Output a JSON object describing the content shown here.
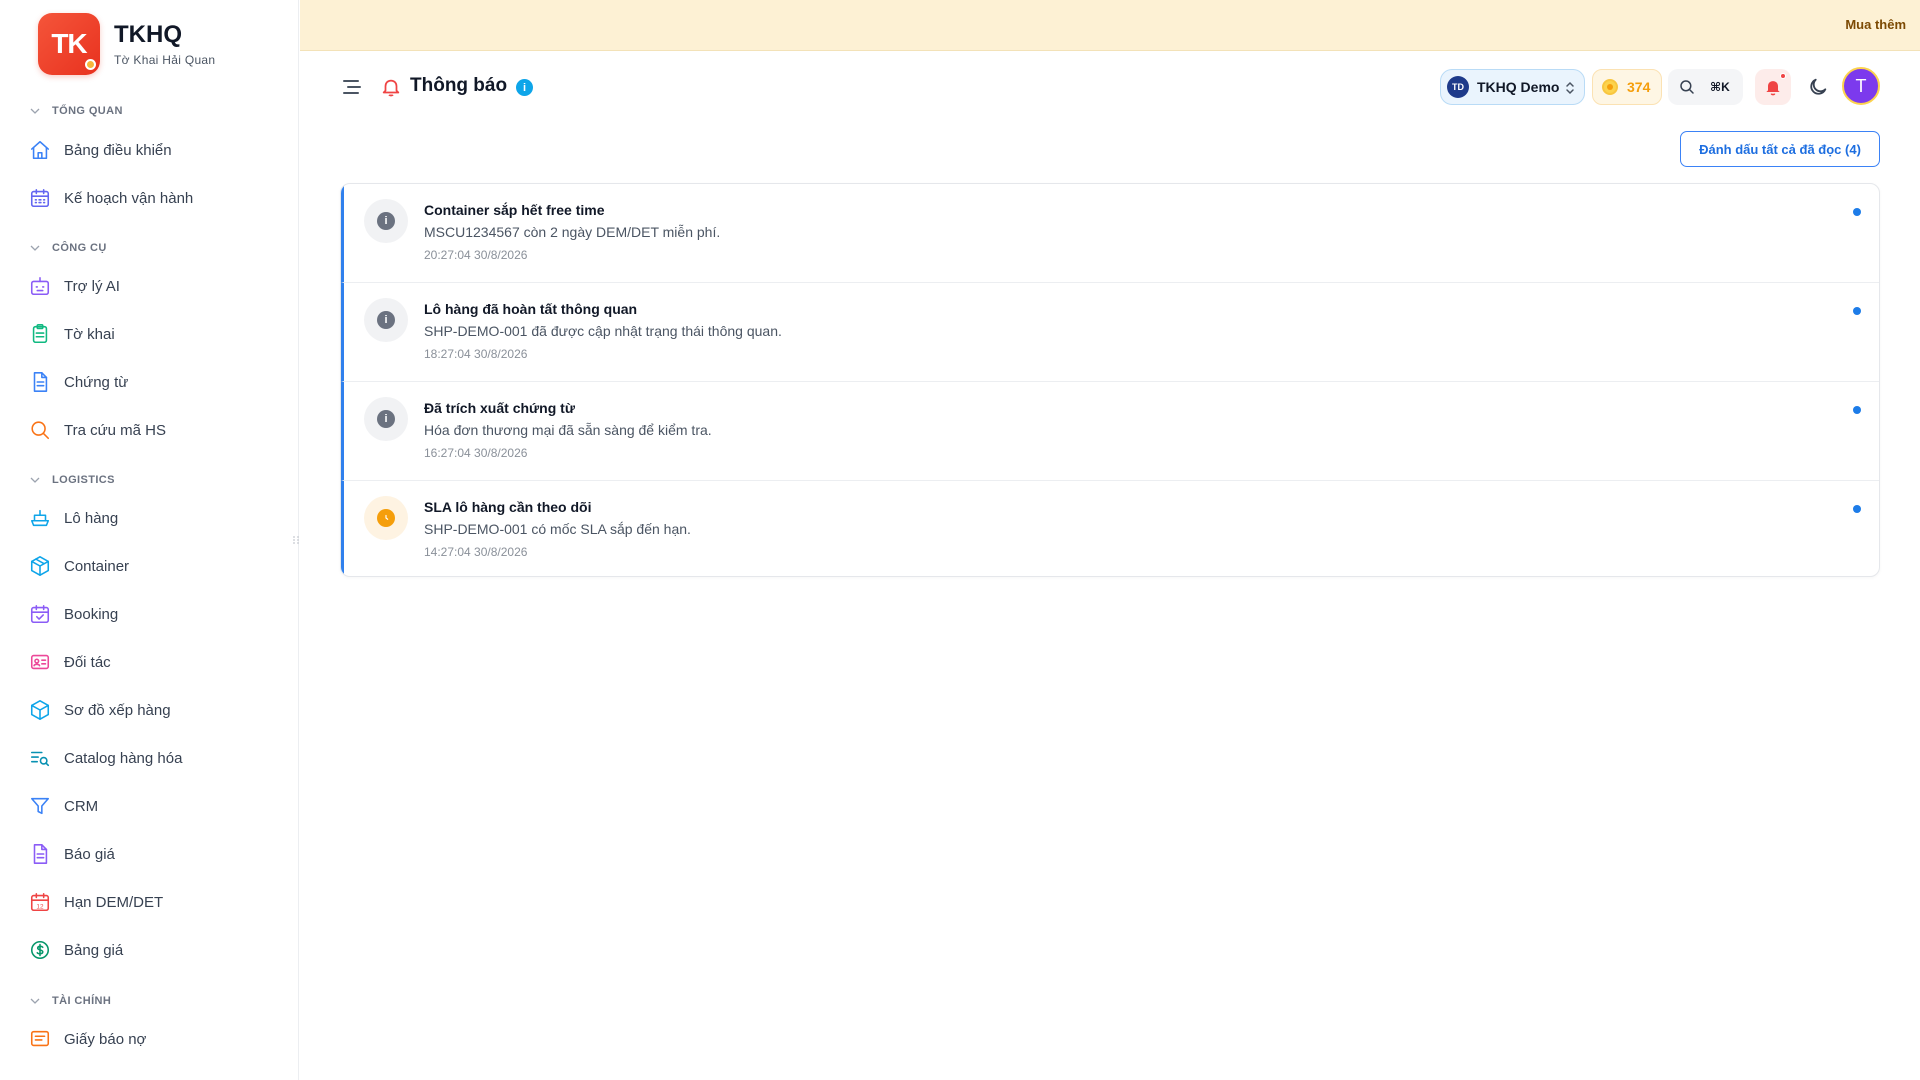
{
  "brand": {
    "logo_text": "TK",
    "name": "TKHQ",
    "subtitle": "Tờ Khai Hải Quan"
  },
  "banner": {
    "cta": "Mua thêm"
  },
  "sidebar": {
    "sections": [
      {
        "label": "TỔNG QUAN",
        "items": [
          {
            "label": "Bảng điều khiển",
            "icon": "home-icon"
          },
          {
            "label": "Kế hoạch vận hành",
            "icon": "calendar-grid-icon"
          }
        ]
      },
      {
        "label": "CÔNG CỤ",
        "items": [
          {
            "label": "Trợ lý AI",
            "icon": "bot-icon"
          },
          {
            "label": "Tờ khai",
            "icon": "clipboard-icon"
          },
          {
            "label": "Chứng từ",
            "icon": "file-text-icon"
          },
          {
            "label": "Tra cứu mã HS",
            "icon": "search-icon"
          }
        ]
      },
      {
        "label": "LOGISTICS",
        "items": [
          {
            "label": "Lô hàng",
            "icon": "ship-icon"
          },
          {
            "label": "Container",
            "icon": "box-icon"
          },
          {
            "label": "Booking",
            "icon": "calendar-check-icon"
          },
          {
            "label": "Đối tác",
            "icon": "id-card-icon"
          },
          {
            "label": "Sơ đồ xếp hàng",
            "icon": "package-icon"
          },
          {
            "label": "Catalog hàng hóa",
            "icon": "list-search-icon"
          },
          {
            "label": "CRM",
            "icon": "funnel-icon"
          },
          {
            "label": "Báo giá",
            "icon": "file-lines-icon"
          },
          {
            "label": "Hạn DEM/DET",
            "icon": "calendar-12-icon"
          },
          {
            "label": "Bảng giá",
            "icon": "dollar-circle-icon"
          }
        ]
      },
      {
        "label": "TÀI CHÍNH",
        "items": [
          {
            "label": "Giấy báo nợ",
            "icon": "message-lines-icon"
          }
        ]
      }
    ]
  },
  "header": {
    "title": "Thông báo",
    "info_icon": "i",
    "org": {
      "initials": "TD",
      "name": "TKHQ Demo"
    },
    "credits": "374",
    "search_shortcut": "⌘K",
    "user_initial": "T"
  },
  "actions": {
    "mark_all_read": "Đánh dấu tất cả đã đọc (4)"
  },
  "notifications": [
    {
      "title": "Container sắp hết free time",
      "desc": "MSCU1234567 còn 2 ngày DEM/DET miễn phí.",
      "time": "20:27:04 30/8/2026",
      "kind": "info",
      "unread": true
    },
    {
      "title": "Lô hàng đã hoàn tất thông quan",
      "desc": "SHP-DEMO-001 đã được cập nhật trạng thái thông quan.",
      "time": "18:27:04 30/8/2026",
      "kind": "info",
      "unread": true
    },
    {
      "title": "Đã trích xuất chứng từ",
      "desc": "Hóa đơn thương mại đã sẵn sàng để kiểm tra.",
      "time": "16:27:04 30/8/2026",
      "kind": "info",
      "unread": true
    },
    {
      "title": "SLA lô hàng cần theo dõi",
      "desc": "SHP-DEMO-001 có mốc SLA sắp đến hạn.",
      "time": "14:27:04 30/8/2026",
      "kind": "warning",
      "unread": true
    }
  ],
  "colors": {
    "accent": "#2f80ed",
    "brand": "#ef3e26",
    "banner": "#fdf1d4",
    "warning": "#f59e0b"
  }
}
